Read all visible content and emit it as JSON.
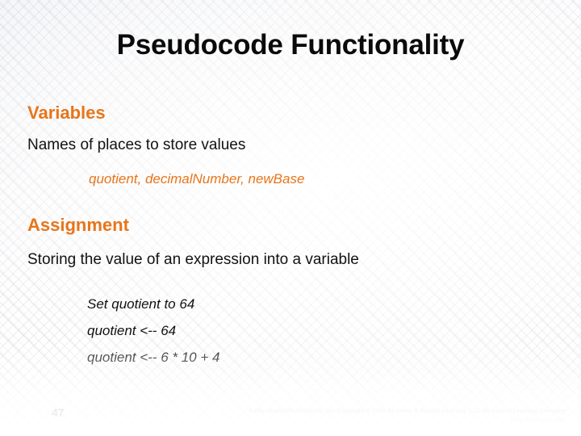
{
  "slide": {
    "title": "Pseudocode Functionality",
    "page_number": "47",
    "accent_color": "#E8751A",
    "text_color": "#111111",
    "background_color": "#ffffff"
  },
  "sections": [
    {
      "heading": "Variables",
      "body": "Names of places to store values",
      "example_inline": "quotient, decimalNumber, newBase"
    },
    {
      "heading": "Assignment",
      "body": "Storing the value of an expression into a variable",
      "examples": [
        "Set quotient to 64",
        "quotient <-- 64",
        "quotient <-- 6 * 10 + 4"
      ]
    }
  ],
  "footer": {
    "credit": "© Eky Studio/ShutterStock, Inc. Copyright © 2016 by Jones & Bartlett Learning, LLC an Ascend Learning Company",
    "url": "www.jblearning.com"
  }
}
